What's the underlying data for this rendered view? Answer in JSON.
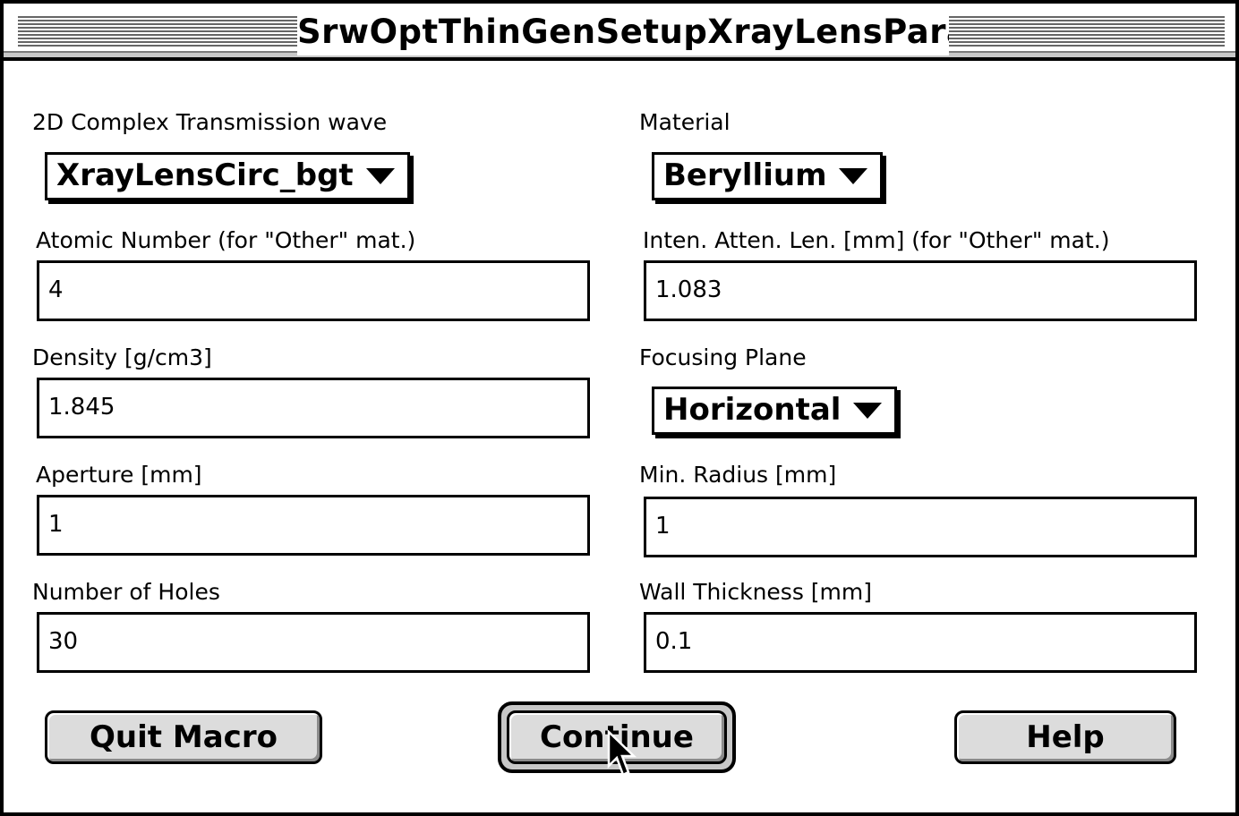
{
  "window": {
    "title": "SrwOptThinGenSetupXrayLensParab"
  },
  "left": {
    "transmission_wave": {
      "label": "2D Complex Transmission wave",
      "value": "XrayLensCirc_bgt"
    },
    "atomic_number": {
      "label": "Atomic Number (for \"Other\" mat.)",
      "value": "4"
    },
    "density": {
      "label": "Density [g/cm3]",
      "value": "1.845"
    },
    "aperture": {
      "label": "Aperture [mm]",
      "value": "1"
    },
    "number_of_holes": {
      "label": "Number of Holes",
      "value": "30"
    }
  },
  "right": {
    "material": {
      "label": "Material",
      "value": "Beryllium"
    },
    "atten_len": {
      "label": "Inten. Atten. Len. [mm] (for \"Other\" mat.)",
      "value": "1.083"
    },
    "focusing_plane": {
      "label": "Focusing Plane",
      "value": "Horizontal"
    },
    "min_radius": {
      "label": "Min. Radius [mm]",
      "value": "1"
    },
    "wall_thickness": {
      "label": "Wall Thickness [mm]",
      "value": "0.1"
    }
  },
  "buttons": {
    "quit": "Quit Macro",
    "continue": "Continue",
    "help": "Help"
  },
  "icons": {
    "popup_arrow": "triangle-down-icon",
    "cursor": "mouse-pointer-icon"
  }
}
